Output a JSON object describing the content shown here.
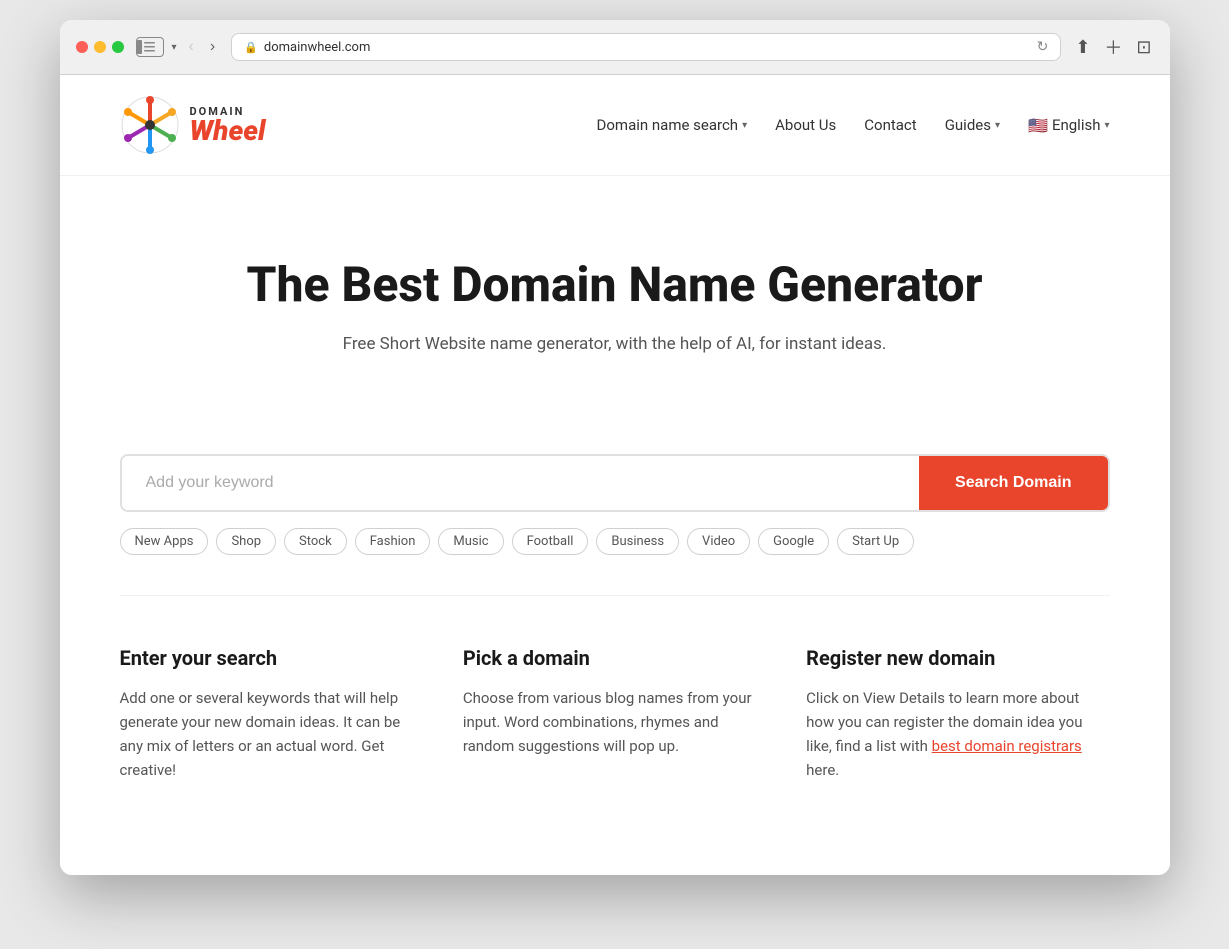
{
  "browser": {
    "url": "domainwheel.com",
    "tab_label": "domainwheel.com"
  },
  "header": {
    "logo_domain": "DOMAIN",
    "logo_wheel": "Wheel",
    "nav": {
      "domain_search": "Domain name search",
      "about_us": "About Us",
      "contact": "Contact",
      "guides": "Guides",
      "language": "English",
      "flag": "🇺🇸"
    }
  },
  "hero": {
    "title": "The Best Domain Name Generator",
    "subtitle": "Free Short Website name generator, with the help of AI, for instant ideas."
  },
  "search": {
    "placeholder": "Add your keyword",
    "button_label": "Search Domain",
    "tags": [
      "New Apps",
      "Shop",
      "Stock",
      "Fashion",
      "Music",
      "Football",
      "Business",
      "Video",
      "Google",
      "Start Up"
    ]
  },
  "info_cards": [
    {
      "title": "Enter your search",
      "body": "Add one or several keywords that will help generate your new domain ideas. It can be any mix of letters or an actual word. Get creative!"
    },
    {
      "title": "Pick a domain",
      "body": "Choose from various blog names from your input. Word combinations, rhymes and random suggestions will pop up."
    },
    {
      "title": "Register new domain",
      "body_pre": "Click on View Details to learn more about how you can register the domain idea you like, find a list with ",
      "link_text": "best domain registrars",
      "body_post": " here."
    }
  ]
}
